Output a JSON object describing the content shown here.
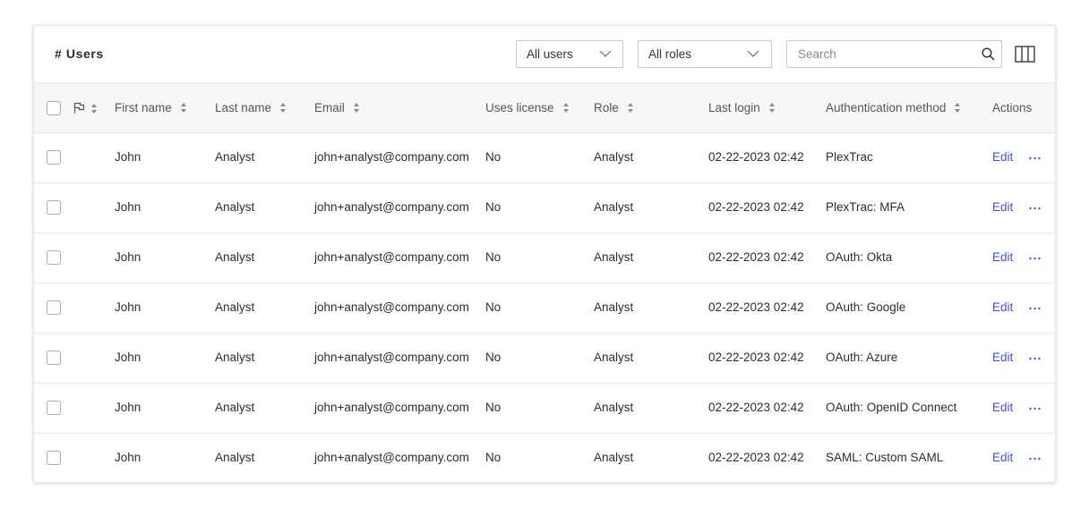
{
  "title": "# Users",
  "filters": {
    "users_select": "All users",
    "roles_select": "All roles",
    "search_placeholder": "Search"
  },
  "columns": {
    "first_name": "First name",
    "last_name": "Last name",
    "email": "Email",
    "uses_license": "Uses license",
    "role": "Role",
    "last_login": "Last login",
    "auth_method": "Authentication method",
    "actions": "Actions"
  },
  "icons": {
    "flag": "flag-icon",
    "sort": "sort-icon",
    "search": "search-icon",
    "columns": "columns-icon",
    "more": "more-horizontal-icon",
    "chevron": "chevron-down-icon"
  },
  "colors": {
    "accent": "#4b4fd8"
  },
  "rows": [
    {
      "first_name": "John",
      "last_name": "Analyst",
      "email": "john+analyst@company.com",
      "uses_license": "No",
      "role": "Analyst",
      "last_login": "02-22-2023 02:42",
      "auth_method": "PlexTrac",
      "action": "Edit"
    },
    {
      "first_name": "John",
      "last_name": "Analyst",
      "email": "john+analyst@company.com",
      "uses_license": "No",
      "role": "Analyst",
      "last_login": "02-22-2023 02:42",
      "auth_method": "PlexTrac: MFA",
      "action": "Edit"
    },
    {
      "first_name": "John",
      "last_name": "Analyst",
      "email": "john+analyst@company.com",
      "uses_license": "No",
      "role": "Analyst",
      "last_login": "02-22-2023 02:42",
      "auth_method": "OAuth: Okta",
      "action": "Edit"
    },
    {
      "first_name": "John",
      "last_name": "Analyst",
      "email": "john+analyst@company.com",
      "uses_license": "No",
      "role": "Analyst",
      "last_login": "02-22-2023 02:42",
      "auth_method": "OAuth: Google",
      "action": "Edit"
    },
    {
      "first_name": "John",
      "last_name": "Analyst",
      "email": "john+analyst@company.com",
      "uses_license": "No",
      "role": "Analyst",
      "last_login": "02-22-2023 02:42",
      "auth_method": "OAuth: Azure",
      "action": "Edit"
    },
    {
      "first_name": "John",
      "last_name": "Analyst",
      "email": "john+analyst@company.com",
      "uses_license": "No",
      "role": "Analyst",
      "last_login": "02-22-2023 02:42",
      "auth_method": "OAuth: OpenID Connect",
      "action": "Edit"
    },
    {
      "first_name": "John",
      "last_name": "Analyst",
      "email": "john+analyst@company.com",
      "uses_license": "No",
      "role": "Analyst",
      "last_login": "02-22-2023 02:42",
      "auth_method": "SAML: Custom SAML",
      "action": "Edit"
    }
  ]
}
